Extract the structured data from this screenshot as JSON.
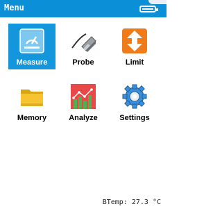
{
  "header": {
    "title": "Menu",
    "battery_icon": "battery-full-icon"
  },
  "menu": {
    "items": [
      {
        "label": "Measure",
        "icon": "measure-icon",
        "selected": true
      },
      {
        "label": "Probe",
        "icon": "probe-icon",
        "selected": false
      },
      {
        "label": "Limit",
        "icon": "limit-icon",
        "selected": false
      },
      {
        "label": "Memory",
        "icon": "memory-folder-icon",
        "selected": false
      },
      {
        "label": "Analyze",
        "icon": "analyze-chart-icon",
        "selected": false
      },
      {
        "label": "Settings",
        "icon": "settings-gear-icon",
        "selected": false
      }
    ]
  },
  "status": {
    "text": "BTemp: 27.3 °C"
  },
  "colors": {
    "header": "#0b8fd6",
    "selected_tile": "#1496dc",
    "background": "#ffffff"
  }
}
